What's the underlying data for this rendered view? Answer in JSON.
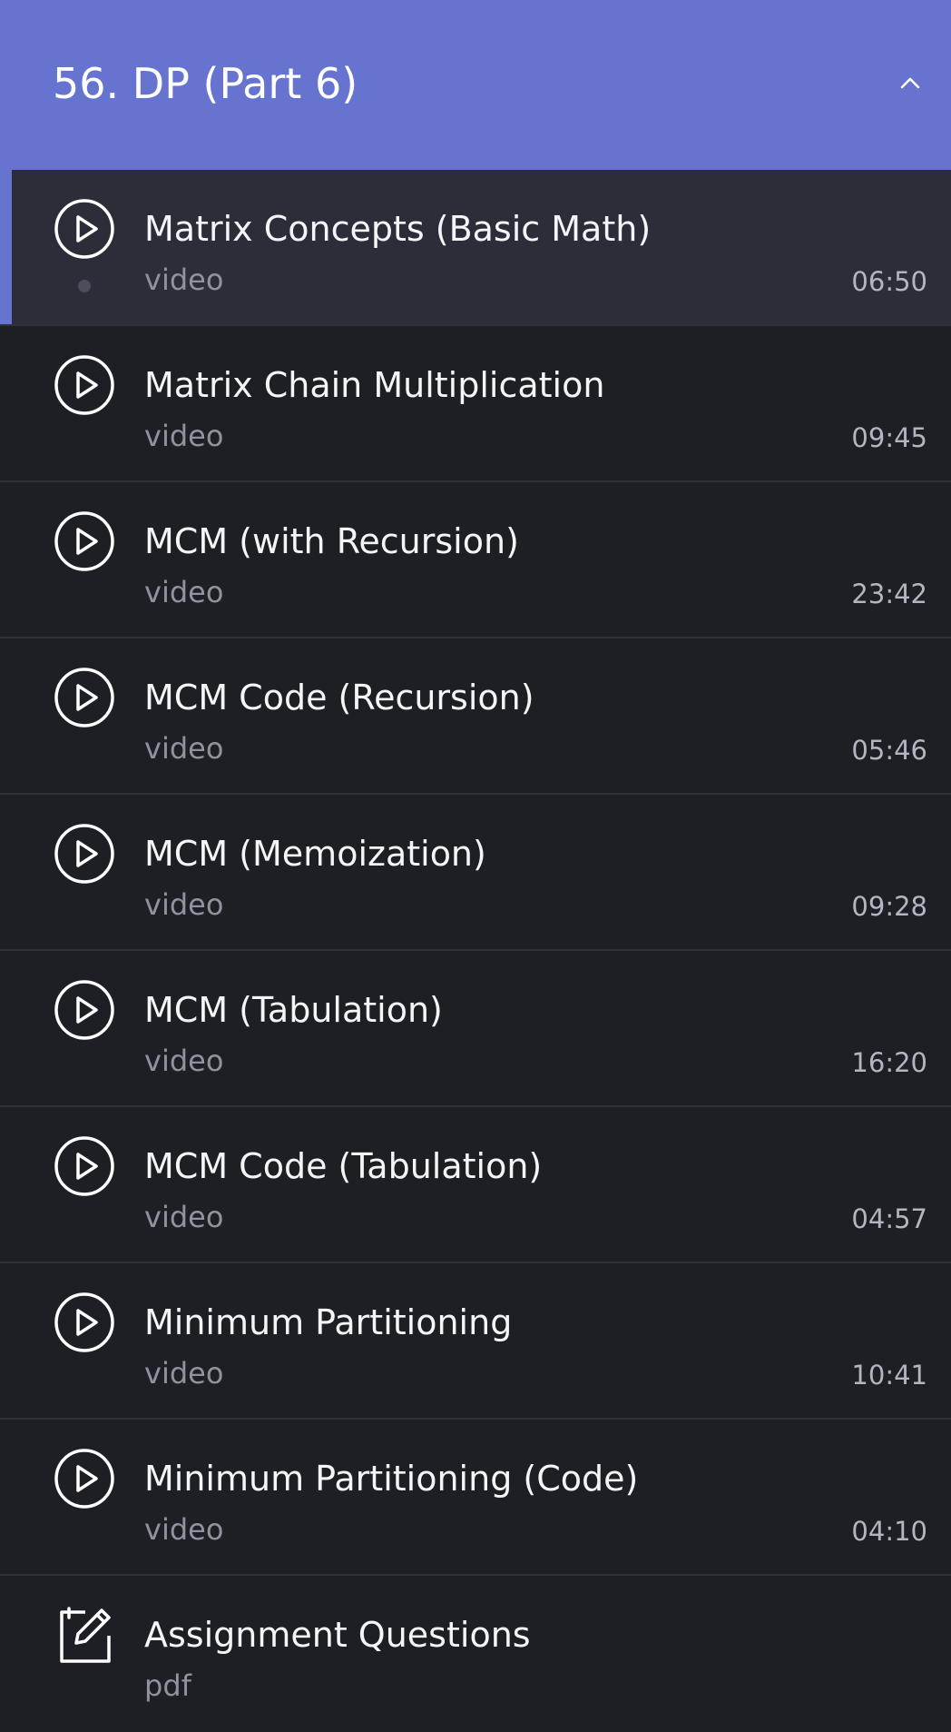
{
  "section": {
    "title": "56. DP (Part 6)"
  },
  "items": [
    {
      "title": "Matrix Concepts (Basic Math)",
      "type": "video",
      "duration": "06:50",
      "icon": "play-circle-icon",
      "active": true
    },
    {
      "title": "Matrix Chain Multiplication",
      "type": "video",
      "duration": "09:45",
      "icon": "play-circle-icon"
    },
    {
      "title": "MCM (with Recursion)",
      "type": "video",
      "duration": "23:42",
      "icon": "play-circle-icon"
    },
    {
      "title": "MCM Code (Recursion)",
      "type": "video",
      "duration": "05:46",
      "icon": "play-circle-icon"
    },
    {
      "title": "MCM (Memoization)",
      "type": "video",
      "duration": "09:28",
      "icon": "play-circle-icon"
    },
    {
      "title": "MCM (Tabulation)",
      "type": "video",
      "duration": "16:20",
      "icon": "play-circle-icon"
    },
    {
      "title": "MCM Code (Tabulation)",
      "type": "video",
      "duration": "04:57",
      "icon": "play-circle-icon"
    },
    {
      "title": "Minimum Partitioning",
      "type": "video",
      "duration": "10:41",
      "icon": "play-circle-icon"
    },
    {
      "title": "Minimum Partitioning (Code)",
      "type": "video",
      "duration": "04:10",
      "icon": "play-circle-icon"
    },
    {
      "title": "Assignment Questions",
      "type": "pdf",
      "duration": "",
      "icon": "edit-document-icon"
    }
  ],
  "colors": {
    "accent": "#6674cf",
    "background": "#1e1f25",
    "active_background": "#2b2e38"
  }
}
